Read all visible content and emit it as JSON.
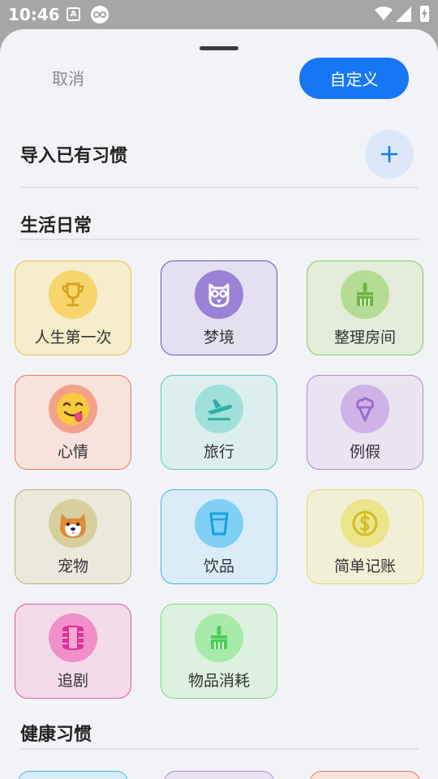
{
  "status_bar": {
    "time": "10:46",
    "a_badge": "A"
  },
  "header": {
    "cancel_label": "取消",
    "custom_label": "自定义"
  },
  "import": {
    "title": "导入已有习惯"
  },
  "sections": {
    "daily_title": "生活日常",
    "health_title": "健康习惯"
  },
  "cards": [
    {
      "label": "人生第一次",
      "icon": "trophy-icon",
      "bg": "#f7eccb",
      "border": "#f2c14e",
      "circle": "#f6d66c",
      "iconColor": "#d9a21b"
    },
    {
      "label": "梦境",
      "icon": "owl-icon",
      "bg": "#e4e0f2",
      "border": "#6a4ec4",
      "circle": "#9a82d6",
      "iconColor": "#5e3fb8"
    },
    {
      "label": "整理房间",
      "icon": "broom-icon",
      "bg": "#e3edd9",
      "border": "#8bc86a",
      "circle": "#b5dc94",
      "iconColor": "#6fb446"
    },
    {
      "label": "心情",
      "icon": "emoji-icon",
      "bg": "#f7e2dc",
      "border": "#ee7a5a",
      "circle": "#f4a18a",
      "iconColor": "#f6c343"
    },
    {
      "label": "旅行",
      "icon": "airplane-icon",
      "bg": "#dcefee",
      "border": "#5cc8c0",
      "circle": "#9fe0db",
      "iconColor": "#2fb0a6"
    },
    {
      "label": "例假",
      "icon": "icecream-icon",
      "bg": "#eae3f2",
      "border": "#b28ad6",
      "circle": "#cfb2e8",
      "iconColor": "#9c6cc8"
    },
    {
      "label": "宠物",
      "icon": "dog-icon",
      "bg": "#ece9dc",
      "border": "#b8b08a",
      "circle": "#d8cf9e",
      "iconColor": "#d88a3a"
    },
    {
      "label": "饮品",
      "icon": "cup-icon",
      "bg": "#d9ecf8",
      "border": "#43b4ea",
      "circle": "#7fd0f4",
      "iconColor": "#1aa2e2"
    },
    {
      "label": "简单记账",
      "icon": "coin-icon",
      "bg": "#f1f0d6",
      "border": "#e2d86a",
      "circle": "#ece48a",
      "iconColor": "#cdbf22"
    },
    {
      "label": "追剧",
      "icon": "film-icon",
      "bg": "#f3dbea",
      "border": "#e455a8",
      "circle": "#f08fc8",
      "iconColor": "#e0309a"
    },
    {
      "label": "物品消耗",
      "icon": "broom-icon",
      "bg": "#ddf2de",
      "border": "#7ddc82",
      "circle": "#a8eaa9",
      "iconColor": "#4fcc57"
    }
  ],
  "colors": {
    "accent": "#1677f5",
    "sheet_bg": "#f2f3f7"
  }
}
